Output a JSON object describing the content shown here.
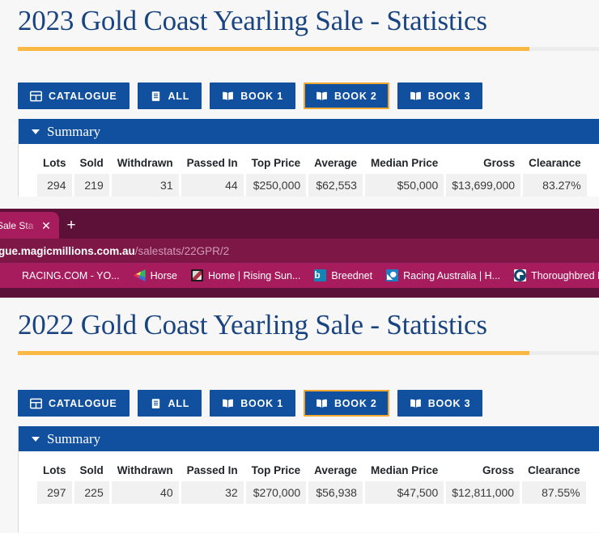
{
  "top_page": {
    "title": "2023 Gold Coast Yearling Sale - Statistics",
    "buttons": [
      {
        "label": "CATALOGUE",
        "icon": "grid-icon",
        "focused": false
      },
      {
        "label": "ALL",
        "icon": "list-document-icon",
        "focused": false
      },
      {
        "label": "BOOK 1",
        "icon": "open-book-icon",
        "focused": false
      },
      {
        "label": "BOOK 2",
        "icon": "open-book-icon",
        "focused": true
      },
      {
        "label": "BOOK 3",
        "icon": "open-book-icon",
        "focused": false
      }
    ],
    "card": {
      "header": "Summary",
      "caret": "caret-down-icon",
      "columns": [
        "Lots",
        "Sold",
        "Withdrawn",
        "Passed In",
        "Top Price",
        "Average",
        "Median Price",
        "Gross",
        "Clearance"
      ],
      "row": [
        "294",
        "219",
        "31",
        "44",
        "$250,000",
        "$62,553",
        "$50,000",
        "$13,699,000",
        "83.27%"
      ]
    }
  },
  "browser": {
    "tab": {
      "title": "Sale Sta",
      "close_icon": "close-icon"
    },
    "new_tab_label": "+",
    "url": {
      "host": "gue.magicmillions.com.au",
      "path": "/salestats/22GPR/2"
    },
    "bookmarks": [
      {
        "label": "RACING.COM - YO...",
        "icon": "racingcom-favicon"
      },
      {
        "label": "Horse",
        "icon": "horse-favicon"
      },
      {
        "label": "Home | Rising Sun...",
        "icon": "risingsun-favicon"
      },
      {
        "label": "Breednet",
        "icon": "breednet-favicon",
        "glyph": "b"
      },
      {
        "label": "Racing Australia | H...",
        "icon": "racingaustralia-favicon"
      },
      {
        "label": "Thoroughbred Bree...",
        "icon": "thoroughbred-favicon"
      }
    ]
  },
  "bottom_page": {
    "title": "2022 Gold Coast Yearling Sale - Statistics",
    "buttons": [
      {
        "label": "CATALOGUE",
        "icon": "grid-icon",
        "focused": false
      },
      {
        "label": "ALL",
        "icon": "list-document-icon",
        "focused": false
      },
      {
        "label": "BOOK 1",
        "icon": "open-book-icon",
        "focused": false
      },
      {
        "label": "BOOK 2",
        "icon": "open-book-icon",
        "focused": true
      },
      {
        "label": "BOOK 3",
        "icon": "open-book-icon",
        "focused": false
      }
    ],
    "card": {
      "header": "Summary",
      "caret": "caret-down-icon",
      "columns": [
        "Lots",
        "Sold",
        "Withdrawn",
        "Passed In",
        "Top Price",
        "Average",
        "Median Price",
        "Gross",
        "Clearance"
      ],
      "row": [
        "297",
        "225",
        "40",
        "32",
        "$270,000",
        "$56,938",
        "$47,500",
        "$12,811,000",
        "87.55%"
      ]
    }
  },
  "colors": {
    "brand_blue": "#11509e",
    "title_blue": "#1a4480",
    "gold": "#fbb943",
    "focus_ring": "#f0a830",
    "chrome_dark": "#5e1138",
    "chrome_mid": "#7d1746",
    "chrome_light": "#a61c5d"
  }
}
